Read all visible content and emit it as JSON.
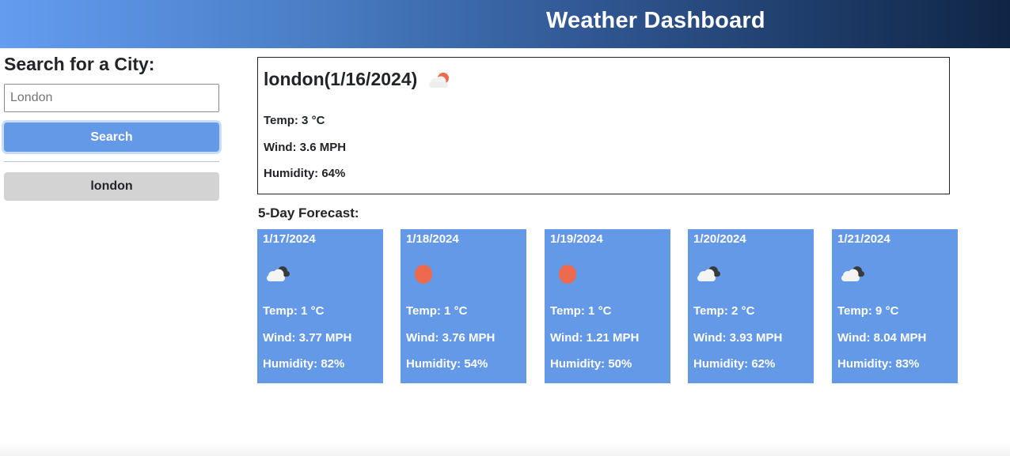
{
  "header": {
    "title": "Weather Dashboard"
  },
  "sidebar": {
    "heading": "Search for a City:",
    "search_placeholder": "London",
    "search_label": "Search",
    "history": [
      "london"
    ]
  },
  "current": {
    "title": "london(1/16/2024)",
    "icon": "partly-cloudy-sun-icon",
    "temp": "Temp: 3 °C",
    "wind": "Wind: 3.6 MPH",
    "humidity": "Humidity: 64%"
  },
  "forecast": {
    "heading": "5-Day Forecast:",
    "days": [
      {
        "date": "1/17/2024",
        "icon": "cloudy-icon",
        "temp": "Temp: 1 °C",
        "wind": "Wind: 3.77 MPH",
        "humidity": "Humidity: 82%"
      },
      {
        "date": "1/18/2024",
        "icon": "sun-icon",
        "temp": "Temp: 1 °C",
        "wind": "Wind: 3.76 MPH",
        "humidity": "Humidity: 54%"
      },
      {
        "date": "1/19/2024",
        "icon": "sun-icon",
        "temp": "Temp: 1 °C",
        "wind": "Wind: 1.21 MPH",
        "humidity": "Humidity: 50%"
      },
      {
        "date": "1/20/2024",
        "icon": "cloudy-icon",
        "temp": "Temp: 2 °C",
        "wind": "Wind: 3.93 MPH",
        "humidity": "Humidity: 62%"
      },
      {
        "date": "1/21/2024",
        "icon": "cloudy-icon",
        "temp": "Temp: 9 °C",
        "wind": "Wind: 8.04 MPH",
        "humidity": "Humidity: 83%"
      }
    ]
  },
  "colors": {
    "accent": "#6499e8",
    "sun": "#ee6a4f",
    "history_bg": "#d3d3d3"
  }
}
